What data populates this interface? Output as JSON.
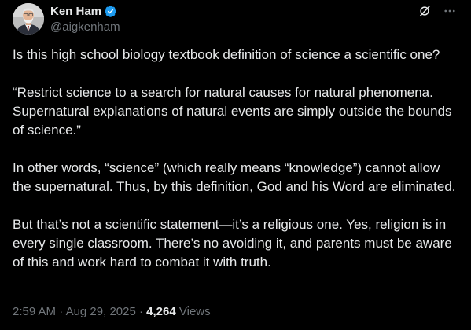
{
  "author": {
    "display_name": "Ken Ham",
    "handle": "@aigkenham",
    "verified": true
  },
  "icons": {
    "verified": "verified-badge-icon",
    "grok": "grok-icon",
    "more": "more-icon"
  },
  "colors": {
    "background": "#000000",
    "text_primary": "#e7e9ea",
    "text_secondary": "#71767b",
    "verified_badge": "#1d9bf0"
  },
  "post": {
    "paragraphs": [
      "Is this high school biology textbook definition of science a scientific one?",
      "“Restrict science to a search for natural causes for natural phenomena. Supernatural explanations of natural events are simply outside the bounds of science.”",
      "In other words, “science” (which really means “knowledge”) cannot allow the supernatural. Thus, by this definition, God and his Word are eliminated.",
      "But that’s not a scientific statement—it’s a religious one. Yes, religion is in every single classroom. There’s no avoiding it, and parents must be aware of this and work hard to combat it with truth."
    ]
  },
  "meta": {
    "time": "2:59 AM",
    "separator": "·",
    "date": "Aug 29, 2025",
    "views_count": "4,264",
    "views_label": "Views"
  }
}
